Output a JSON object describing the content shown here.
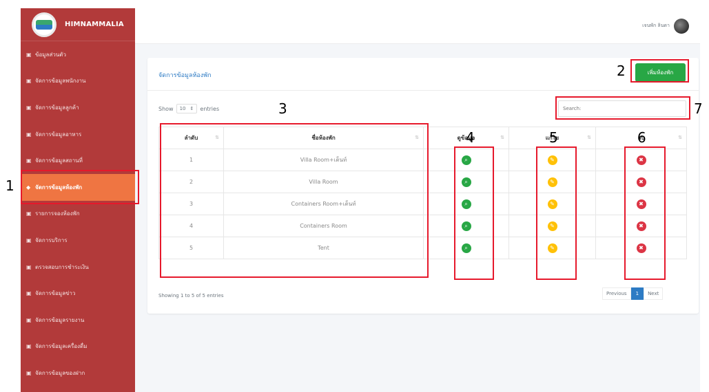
{
  "brand": {
    "name": "HIMNAMMALIA"
  },
  "sidebar": {
    "items": [
      {
        "icon": "▣",
        "label": "ข้อมูลส่วนตัว"
      },
      {
        "icon": "▣",
        "label": "จัดการข้อมูลพนักงาน"
      },
      {
        "icon": "▣",
        "label": "จัดการข้อมูลลูกค้า"
      },
      {
        "icon": "▣",
        "label": "จัดการข้อมูลอาหาร"
      },
      {
        "icon": "▣",
        "label": "จัดการข้อมูลสถานที่"
      },
      {
        "icon": "◆",
        "label": "จัดการข้อมูลห้องพัก"
      },
      {
        "icon": "▣",
        "label": "รายการจองห้องพัก"
      },
      {
        "icon": "▣",
        "label": "จัดการบริการ"
      },
      {
        "icon": "▣",
        "label": "ตรวจสอบการชำระเงิน"
      },
      {
        "icon": "▣",
        "label": "จัดการข้อมูลข่าว"
      },
      {
        "icon": "▣",
        "label": "จัดการข้อมูลรายงาน"
      },
      {
        "icon": "▣",
        "label": "จัดการข้อมูลเครื่องดื่ม"
      },
      {
        "icon": "▣",
        "label": "จัดการข้อมูลของฝาก"
      }
    ]
  },
  "topbar": {
    "username": "เจนพัก ลินดา"
  },
  "card": {
    "title": "จัดการข้อมูลห้องพัก",
    "add_button": "เพิ่มห้องพัก",
    "show_label": "Show",
    "entries_value": "10",
    "entries_label": "entries",
    "search_placeholder": "Search:",
    "showing_text": "Showing 1 to 5 of 5 entries",
    "pager": {
      "previous": "Previous",
      "current": "1",
      "next": "Next"
    }
  },
  "table": {
    "headers": [
      "ลำดับ",
      "ชื่อห้องพัก",
      "ดูข้อมูล",
      "แก้ไข",
      "ลบ"
    ],
    "rows": [
      {
        "no": "1",
        "name": "Villa Room+เต็นท์"
      },
      {
        "no": "2",
        "name": "Villa Room"
      },
      {
        "no": "3",
        "name": "Containers Room+เต็นท์"
      },
      {
        "no": "4",
        "name": "Containers Room"
      },
      {
        "no": "5",
        "name": "Tent"
      }
    ]
  },
  "annotations": {
    "labels": [
      "1",
      "2",
      "3",
      "4",
      "5",
      "6",
      "7"
    ],
    "color": "#e6182b"
  },
  "colors": {
    "sidebar": "#b23a3a",
    "sidebar_active": "#ef7542",
    "primary_button": "#28a745",
    "view": "#28a745",
    "edit": "#ffc107",
    "delete": "#dc3545",
    "title_text": "#2d7bc4"
  }
}
